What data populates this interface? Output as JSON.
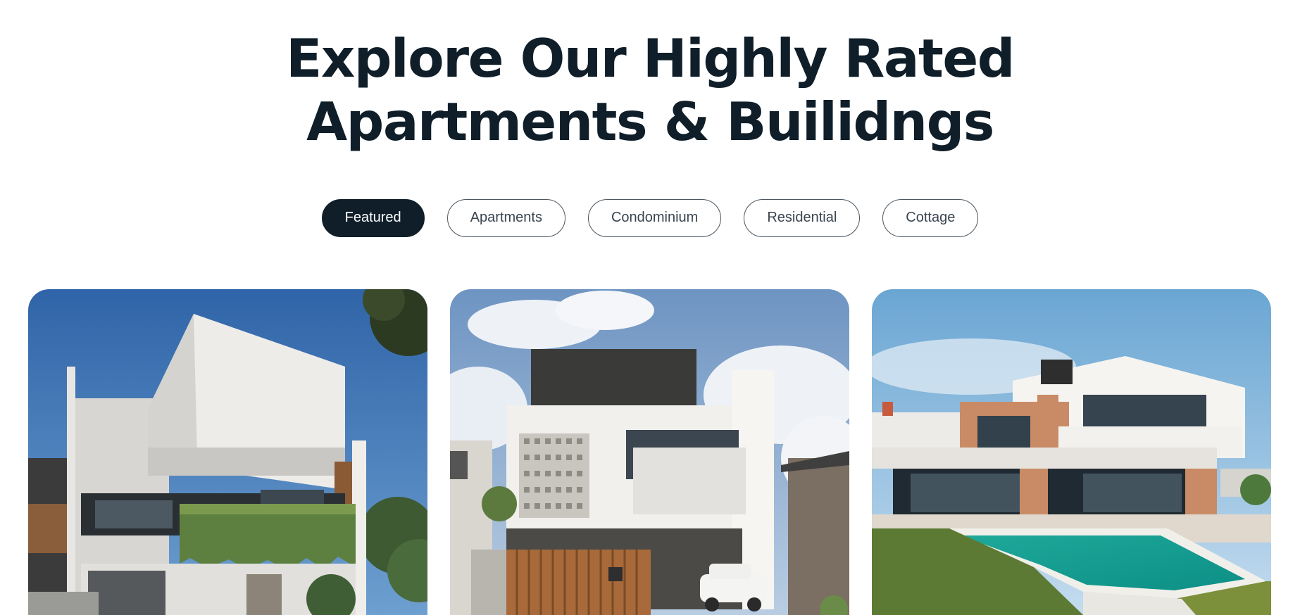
{
  "headline": {
    "line1": "Explore Our Highly Rated",
    "line2": "Apartments & Builidngs"
  },
  "filters": [
    {
      "label": "Featured",
      "active": true
    },
    {
      "label": "Apartments",
      "active": false
    },
    {
      "label": "Condominium",
      "active": false
    },
    {
      "label": "Residential",
      "active": false
    },
    {
      "label": "Cottage",
      "active": false
    }
  ],
  "colors": {
    "text_dark": "#0f1e29",
    "pill_border": "#4b5660",
    "pill_text": "#3a4550",
    "background": "#ffffff"
  },
  "cards": [
    {
      "image": "modern-white-house-with-hanging-plants-photo"
    },
    {
      "image": "minimalist-house-with-car-and-wooden-gate-photo"
    },
    {
      "image": "villa-with-swimming-pool-photo"
    }
  ]
}
